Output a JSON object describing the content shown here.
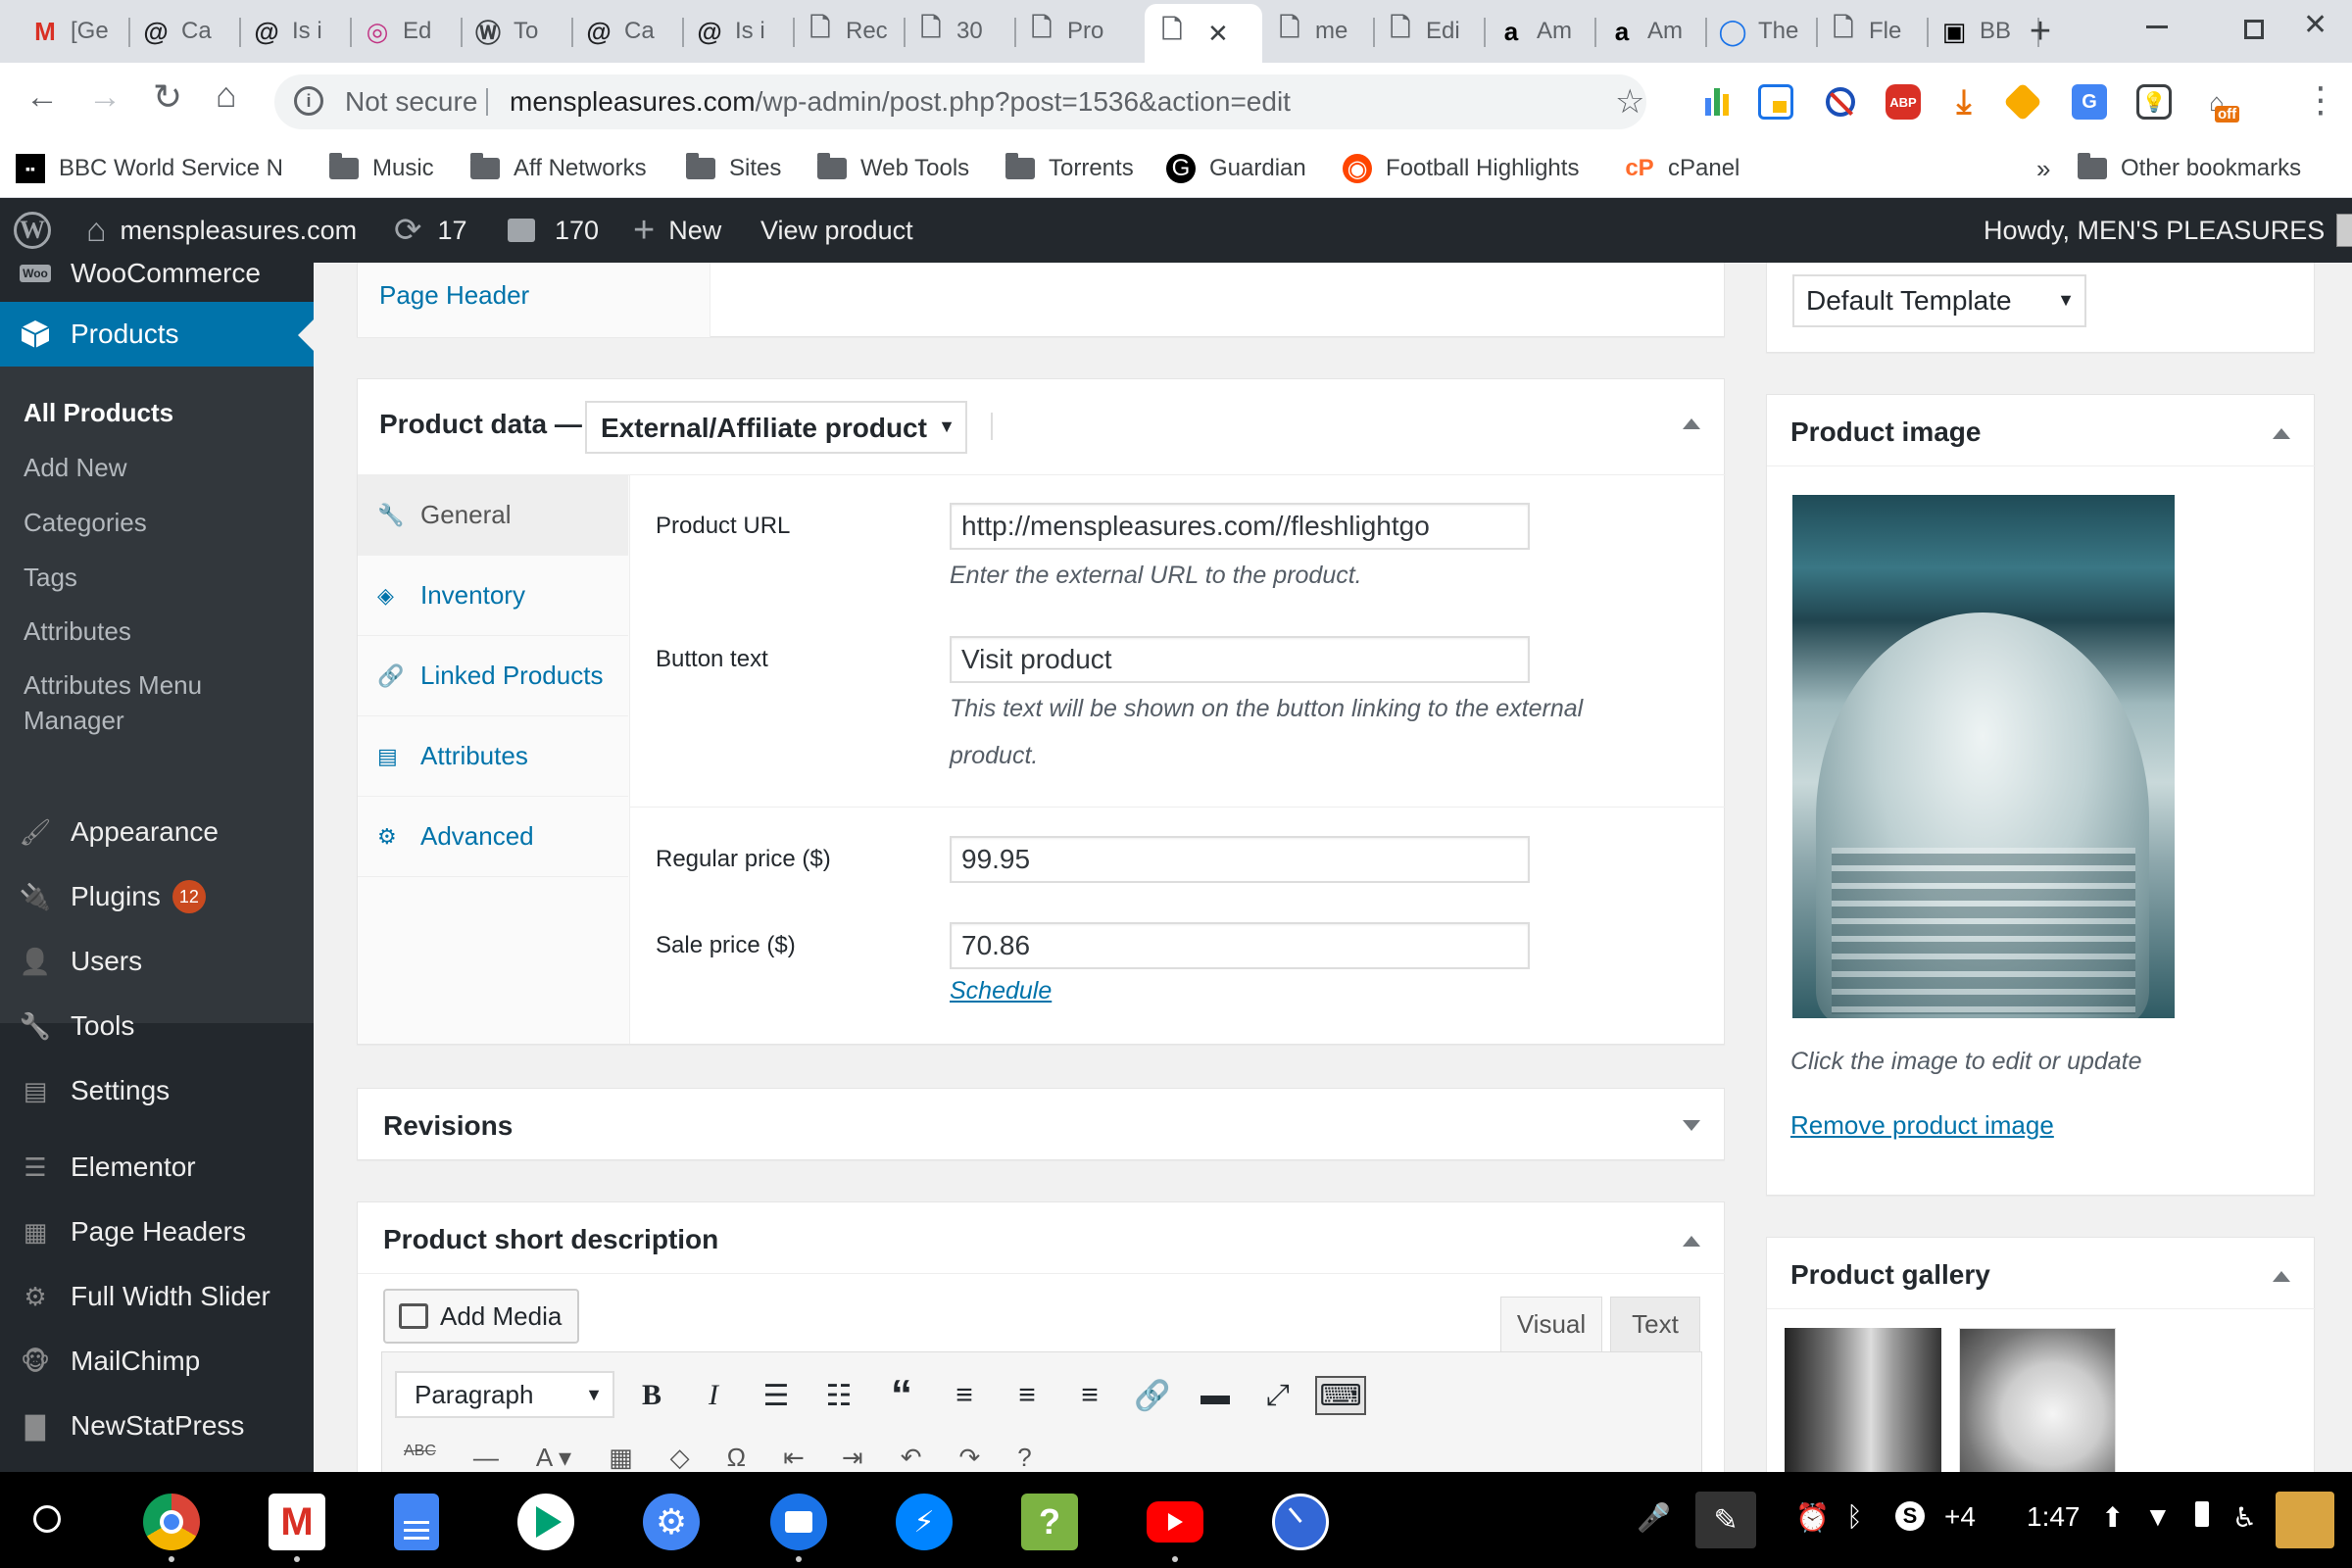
{
  "browser": {
    "tabs": [
      {
        "title": "[Ge",
        "icon": "gmail-icon"
      },
      {
        "title": "Ca",
        "icon": "at-sign-icon"
      },
      {
        "title": "Is i",
        "icon": "at-sign-icon"
      },
      {
        "title": "Ed",
        "icon": "instagram-icon"
      },
      {
        "title": "To",
        "icon": "wordpress-icon"
      },
      {
        "title": "Ca",
        "icon": "at-sign-icon"
      },
      {
        "title": "Is i",
        "icon": "at-sign-icon"
      },
      {
        "title": "Rec",
        "icon": "page-icon"
      },
      {
        "title": "30",
        "icon": "page-icon"
      },
      {
        "title": "Pro",
        "icon": "page-icon"
      },
      {
        "title": "",
        "icon": "page-icon",
        "active": true
      },
      {
        "title": "me",
        "icon": "page-icon"
      },
      {
        "title": "Edi",
        "icon": "page-icon"
      },
      {
        "title": "Am",
        "icon": "amazon-icon"
      },
      {
        "title": "Am",
        "icon": "amazon-icon"
      },
      {
        "title": "The",
        "icon": "circle-icon"
      },
      {
        "title": "Fle",
        "icon": "page-icon"
      },
      {
        "title": "BB",
        "icon": "bbc-icon"
      }
    ],
    "security": "Not secure",
    "url_domain": "menspleasures.com",
    "url_path": "/wp-admin/post.php?post=1536&action=edit",
    "bookmarks": [
      {
        "label": "BBC World Service N",
        "icon": "bbc-icon"
      },
      {
        "label": "Music",
        "icon": "folder-icon"
      },
      {
        "label": "Aff Networks",
        "icon": "folder-icon"
      },
      {
        "label": "Sites",
        "icon": "folder-icon"
      },
      {
        "label": "Web Tools",
        "icon": "folder-icon"
      },
      {
        "label": "Torrents",
        "icon": "folder-icon"
      },
      {
        "label": "Guardian",
        "icon": "guardian-icon"
      },
      {
        "label": "Football Highlights",
        "icon": "reddit-icon"
      },
      {
        "label": "cPanel",
        "icon": "cpanel-icon"
      }
    ],
    "more_bookmarks": "»",
    "other_bookmarks": "Other bookmarks",
    "ext_off_badge": "off",
    "abp_label": "ABP"
  },
  "adminbar": {
    "site": "menspleasures.com",
    "updates": "17",
    "comments": "170",
    "new": "New",
    "view": "View product",
    "howdy": "Howdy, MEN'S PLEASURES"
  },
  "sidebar": {
    "woo": "WooCommerce",
    "woo_badge": "Woo",
    "products": "Products",
    "submenu": [
      "All Products",
      "Add New",
      "Categories",
      "Tags",
      "Attributes",
      "Attributes Menu",
      "Manager"
    ],
    "items": [
      {
        "label": "Appearance",
        "icon": "paintbrush-icon"
      },
      {
        "label": "Plugins",
        "icon": "plugin-icon",
        "badge": "12"
      },
      {
        "label": "Users",
        "icon": "users-icon"
      },
      {
        "label": "Tools",
        "icon": "wrench-icon"
      },
      {
        "label": "Settings",
        "icon": "settings-icon"
      },
      {
        "label": "Elementor",
        "icon": "elementor-icon"
      },
      {
        "label": "Page Headers",
        "icon": "page-headers-icon"
      },
      {
        "label": "Full Width Slider",
        "icon": "gear-icon"
      },
      {
        "label": "MailChimp",
        "icon": "mailchimp-icon"
      },
      {
        "label": "NewStatPress",
        "icon": "stats-icon"
      }
    ]
  },
  "content": {
    "page_header_link": "Page Header",
    "template": "Default Template",
    "product_data_label": "Product data —",
    "product_type": "External/Affiliate product",
    "tabs": [
      {
        "label": "General",
        "icon": "wrench-icon"
      },
      {
        "label": "Inventory",
        "icon": "tag-icon"
      },
      {
        "label": "Linked Products",
        "icon": "link-icon"
      },
      {
        "label": "Attributes",
        "icon": "list-icon"
      },
      {
        "label": "Advanced",
        "icon": "gear-icon"
      }
    ],
    "fields": {
      "url_label": "Product URL",
      "url_value": "http://menspleasures.com//fleshlightgo",
      "url_desc": "Enter the external URL to the product.",
      "btn_label": "Button text",
      "btn_value": "Visit product",
      "btn_desc_1": "This text will be shown on the button linking to the external",
      "btn_desc_2": "product.",
      "regular_label": "Regular price ($)",
      "regular_value": "99.95",
      "sale_label": "Sale price ($)",
      "sale_value": "70.86",
      "schedule": "Schedule"
    },
    "revisions": "Revisions",
    "short_desc": "Product short description",
    "add_media": "Add Media",
    "visual": "Visual",
    "text": "Text",
    "format": "Paragraph",
    "product_image_title": "Product image",
    "image_hint": "Click the image to edit or update",
    "remove_image": "Remove product image",
    "gallery_title": "Product gallery"
  },
  "shelf": {
    "time": "1:47",
    "extra": "+4"
  },
  "colors": {
    "wp_dark": "#23282d",
    "wp_blue": "#0073aa",
    "active_menu": "#0073aa",
    "badge": "#ca4a1f"
  }
}
